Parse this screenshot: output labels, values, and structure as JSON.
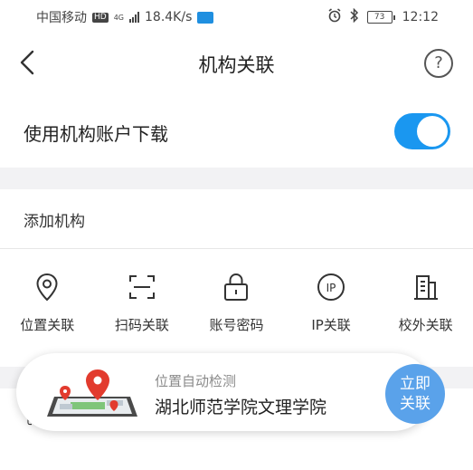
{
  "status_bar": {
    "carrier": "中国移动",
    "hd_badge": "HD",
    "network_type": "4G",
    "speed": "18.4K/s",
    "battery": "73",
    "time": "12:12"
  },
  "nav": {
    "title": "机构关联",
    "help_symbol": "?"
  },
  "account_download": {
    "label": "使用机构账户下载",
    "enabled": true
  },
  "add_institution": {
    "title": "添加机构",
    "options": [
      {
        "label": "位置关联",
        "icon": "location-pin-icon"
      },
      {
        "label": "扫码关联",
        "icon": "scan-icon"
      },
      {
        "label": "账号密码",
        "icon": "lock-icon"
      },
      {
        "label": "IP关联",
        "icon": "ip-icon"
      },
      {
        "label": "校外关联",
        "icon": "building-icon"
      }
    ]
  },
  "location_popup": {
    "subtitle": "位置自动检测",
    "institution": "湖北师范学院文理学院",
    "button_line1": "立即",
    "button_line2": "关联"
  },
  "colors": {
    "accent": "#1a97f0",
    "popup_button": "#5aa2ea",
    "section_gap": "#f2f2f4"
  }
}
